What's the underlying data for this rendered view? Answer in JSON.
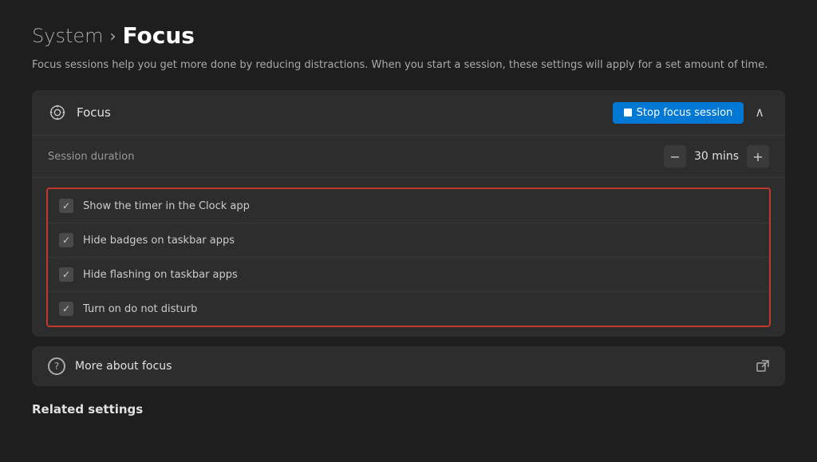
{
  "breadcrumb": {
    "system": "System",
    "separator": "›",
    "current": "Focus"
  },
  "description": "Focus sessions help you get more done by reducing distractions. When you start a session, these settings will apply for a set amount of time.",
  "main_card": {
    "title": "Focus",
    "stop_button_label": "Stop focus session",
    "chevron": "∧"
  },
  "session": {
    "label": "Session duration",
    "minus": "−",
    "plus": "+",
    "value": "30",
    "unit": "mins"
  },
  "options": [
    {
      "id": "timer",
      "label": "Show the timer in the Clock app",
      "checked": true
    },
    {
      "id": "badges",
      "label": "Hide badges on taskbar apps",
      "checked": true
    },
    {
      "id": "flashing",
      "label": "Hide flashing on taskbar apps",
      "checked": true
    },
    {
      "id": "dnd",
      "label": "Turn on do not disturb",
      "checked": true
    }
  ],
  "more_focus": {
    "label": "More about focus"
  },
  "related_settings": {
    "label": "Related settings"
  },
  "icons": {
    "checkmark": "✓",
    "external": "⊹"
  }
}
